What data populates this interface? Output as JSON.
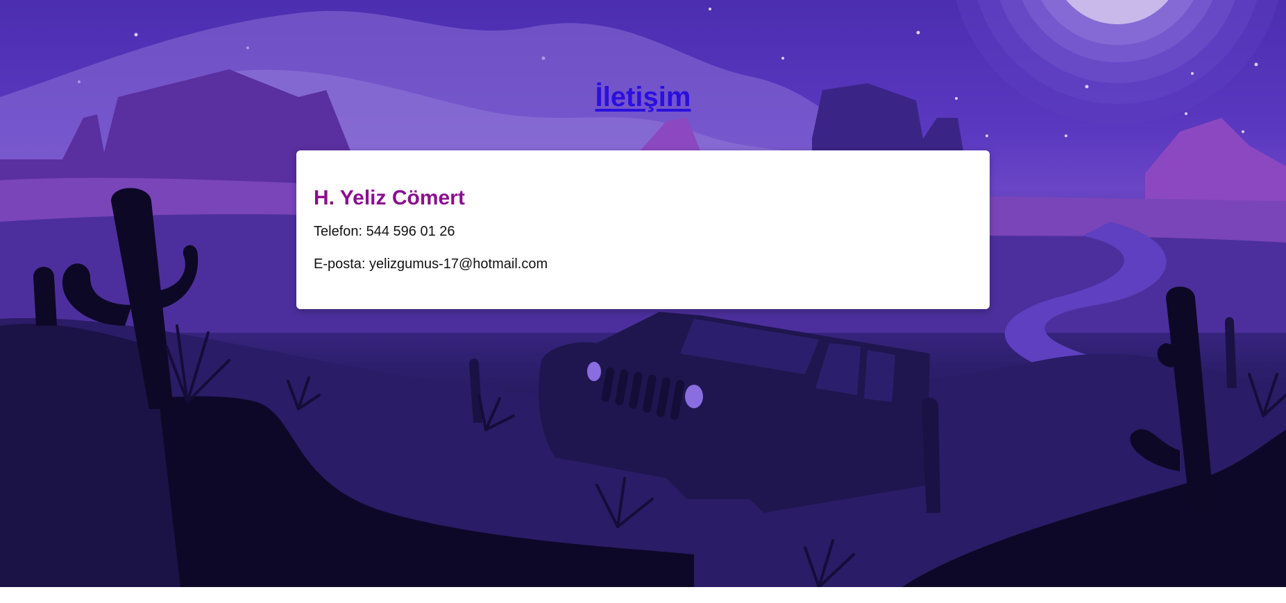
{
  "page": {
    "title": "İletişim",
    "title_color": "#2a0fe0"
  },
  "contact": {
    "name": "H. Yeliz Cömert",
    "name_color": "#8a0e8e",
    "phone_label": "Telefon:",
    "phone_value": "544 596 01 26",
    "email_label": "E-posta:",
    "email_value": "yelizgumus-17@hotmail.com"
  },
  "background": {
    "scene": "desert-night-jeep-illustration",
    "colors": [
      "#4c2eb0",
      "#6a46c6",
      "#2e1f6e",
      "#0e0828"
    ]
  }
}
